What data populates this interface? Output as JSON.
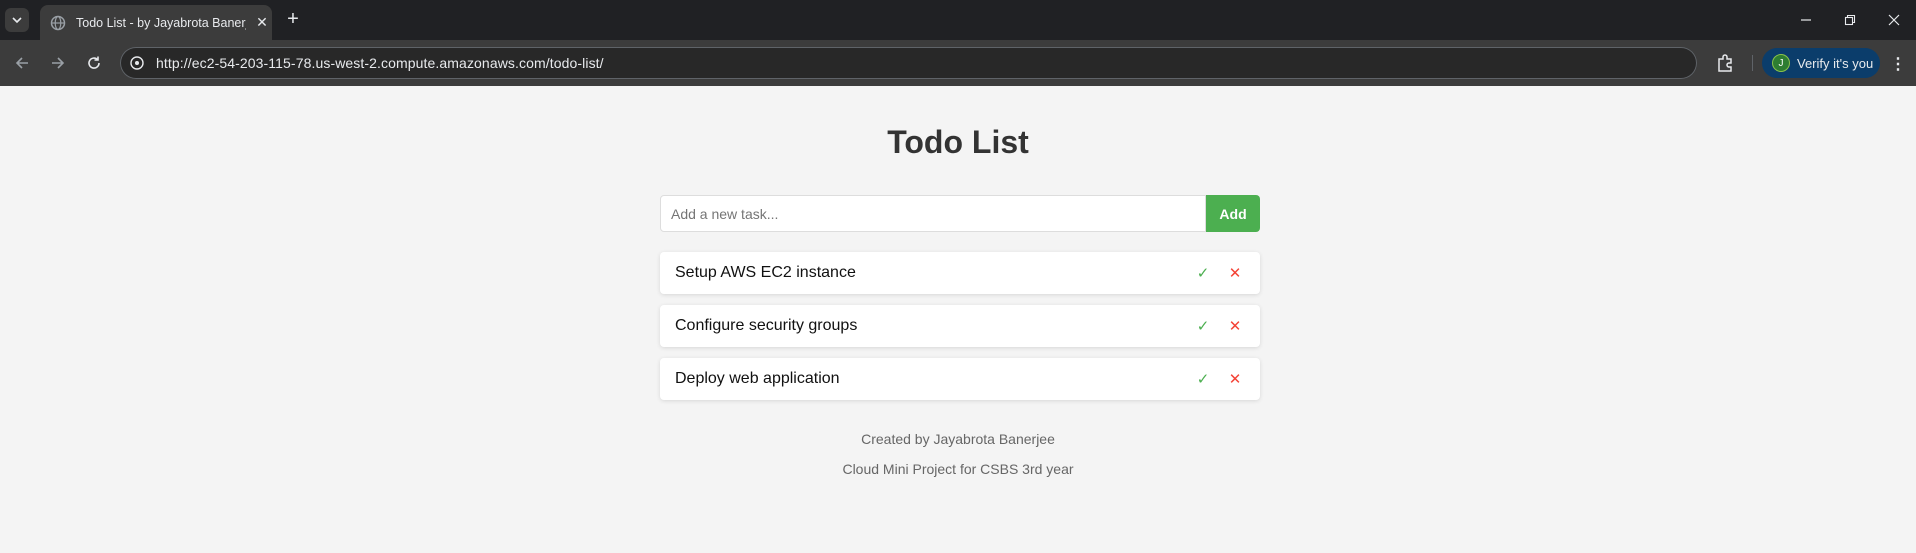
{
  "browser": {
    "tab_title": "Todo List - by Jayabrota Banerjee",
    "url": "http://ec2-54-203-115-78.us-west-2.compute.amazonaws.com/todo-list/",
    "profile_initial": "J",
    "profile_label": "Verify it's you",
    "icons": [
      "tab-search-icon",
      "globe-icon",
      "close-icon",
      "plus-icon",
      "minimize-icon",
      "restore-icon",
      "close-window-icon",
      "back-icon",
      "forward-icon",
      "reload-icon",
      "site-info-icon",
      "extensions-icon",
      "menu-icon"
    ]
  },
  "app": {
    "title": "Todo List",
    "input_placeholder": "Add a new task...",
    "add_label": "Add",
    "todos": [
      {
        "text": "Setup AWS EC2 instance",
        "done_symbol": "✓",
        "delete_symbol": "✕"
      },
      {
        "text": "Configure security groups",
        "done_symbol": "✓",
        "delete_symbol": "✕"
      },
      {
        "text": "Deploy web application",
        "done_symbol": "✓",
        "delete_symbol": "✕"
      }
    ],
    "footer": {
      "credit": "Created by Jayabrota Banerjee",
      "project": "Cloud Mini Project for CSBS 3rd year"
    }
  },
  "colors": {
    "accent_green": "#4caf50",
    "delete_red": "#f44336",
    "page_bg": "#f4f4f4"
  }
}
